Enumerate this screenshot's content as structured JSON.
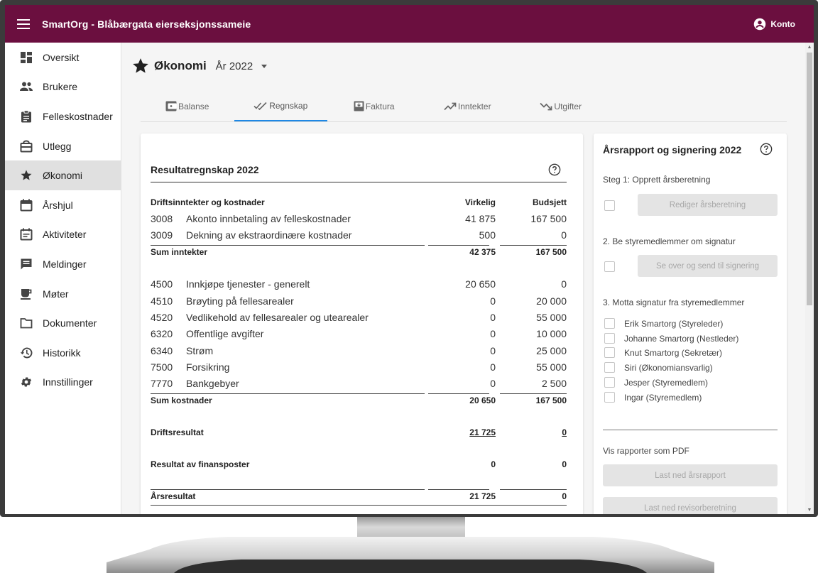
{
  "appbar": {
    "title": "SmartOrg - Blåbærgata eierseksjonssameie",
    "account_label": "Konto"
  },
  "sidebar": {
    "items": [
      {
        "label": "Oversikt",
        "icon": "dashboard-icon"
      },
      {
        "label": "Brukere",
        "icon": "people-icon"
      },
      {
        "label": "Felleskostnader",
        "icon": "clipboard-icon"
      },
      {
        "label": "Utlegg",
        "icon": "receipt-box-icon"
      },
      {
        "label": "Økonomi",
        "icon": "star-icon",
        "active": true
      },
      {
        "label": "Årshjul",
        "icon": "calendar-icon"
      },
      {
        "label": "Aktiviteter",
        "icon": "event-note-icon"
      },
      {
        "label": "Meldinger",
        "icon": "message-icon"
      },
      {
        "label": "Møter",
        "icon": "coffee-icon"
      },
      {
        "label": "Dokumenter",
        "icon": "folder-icon"
      },
      {
        "label": "Historikk",
        "icon": "history-icon"
      },
      {
        "label": "Innstillinger",
        "icon": "gear-icon"
      }
    ]
  },
  "page": {
    "title": "Økonomi",
    "year_label": "År 2022"
  },
  "tabs": [
    {
      "label": "Balanse",
      "icon": "wallet-icon"
    },
    {
      "label": "Regnskap",
      "icon": "double-check-icon",
      "active": true
    },
    {
      "label": "Faktura",
      "icon": "inbox-icon"
    },
    {
      "label": "Inntekter",
      "icon": "trending-up-icon"
    },
    {
      "label": "Utgifter",
      "icon": "trending-down-icon"
    }
  ],
  "result": {
    "title": "Resultatregnskap 2022",
    "header": {
      "label": "Driftsinntekter og kostnader",
      "col1": "Virkelig",
      "col2": "Budsjett"
    },
    "income_rows": [
      {
        "account": "3008",
        "desc": "Akonto innbetaling av felleskostnader",
        "actual": "41 875",
        "budget": "167 500"
      },
      {
        "account": "3009",
        "desc": "Dekning av ekstraordinære kostnader",
        "actual": "500",
        "budget": "0"
      }
    ],
    "sum_income": {
      "label": "Sum inntekter",
      "actual": "42 375",
      "budget": "167 500"
    },
    "cost_rows": [
      {
        "account": "4500",
        "desc": "Innkjøpe tjenester - generelt",
        "actual": "20 650",
        "budget": "0"
      },
      {
        "account": "4510",
        "desc": "Brøyting på fellesarealer",
        "actual": "0",
        "budget": "20 000"
      },
      {
        "account": "4520",
        "desc": "Vedlikehold av fellesarealer og utearealer",
        "actual": "0",
        "budget": "55 000"
      },
      {
        "account": "6320",
        "desc": "Offentlige avgifter",
        "actual": "0",
        "budget": "10 000"
      },
      {
        "account": "6340",
        "desc": "Strøm",
        "actual": "0",
        "budget": "25 000"
      },
      {
        "account": "7500",
        "desc": "Forsikring",
        "actual": "0",
        "budget": "55 000"
      },
      {
        "account": "7770",
        "desc": "Bankgebyer",
        "actual": "0",
        "budget": "2 500"
      }
    ],
    "sum_costs": {
      "label": "Sum kostnader",
      "actual": "20 650",
      "budget": "167 500"
    },
    "operating": {
      "label": "Driftsresultat",
      "actual": "21 725",
      "budget": "0"
    },
    "finance": {
      "label": "Resultat av finansposter",
      "actual": "0",
      "budget": "0"
    },
    "annual": {
      "label": "Årsresultat",
      "actual": "21 725",
      "budget": "0"
    }
  },
  "signing": {
    "title": "Årsrapport og signering 2022",
    "step1_label": "Steg 1: Opprett årsberetning",
    "step1_button": "Rediger årsberetning",
    "step2_label": "2. Be styremedlemmer om signatur",
    "step2_button": "Se over og send til signering",
    "step3_label": "3. Motta signatur fra styremedlemmer",
    "members": [
      "Erik Smartorg (Styreleder)",
      "Johanne Smartorg (Nestleder)",
      "Knut Smartorg (Sekretær)",
      "Siri (Økonomiansvarlig)",
      "Jesper (Styremedlem)",
      "Ingar (Styremedlem)"
    ],
    "reports_label": "Vis rapporter som PDF",
    "download_annual": "Last ned årsrapport",
    "download_auditor": "Last ned revisorberetning"
  },
  "colors": {
    "appbar": "#6b0f3f",
    "tab_indicator": "#1e88e5",
    "active_sidebar": "#e0e0e0"
  }
}
